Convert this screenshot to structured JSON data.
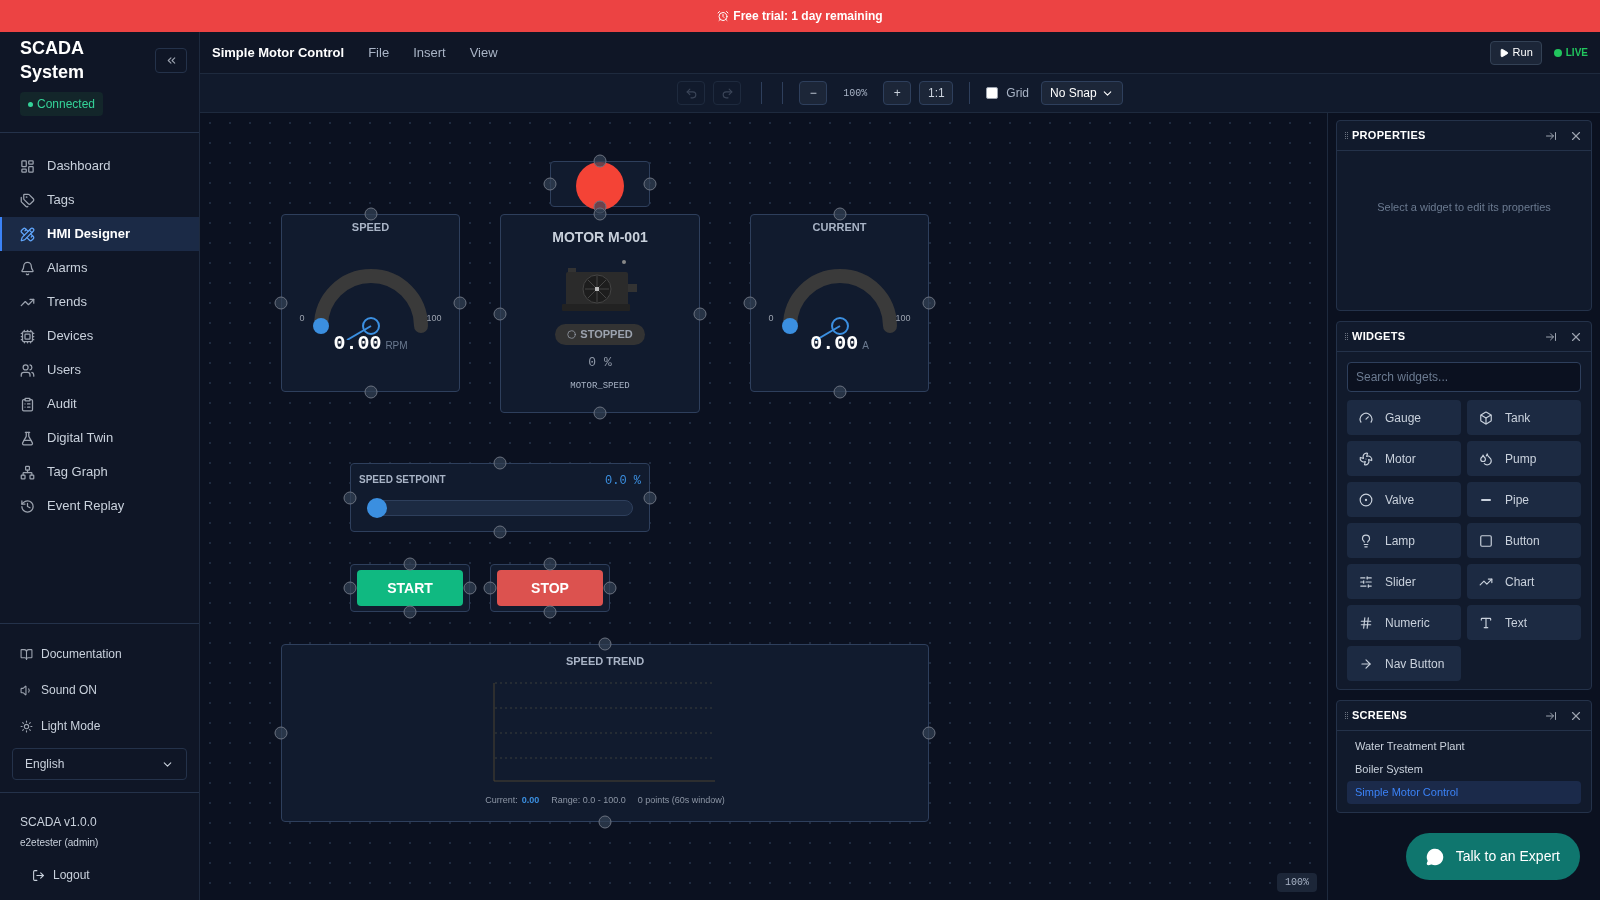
{
  "banner": {
    "text": "Free trial: 1 day remaining"
  },
  "sidebar": {
    "title": "SCADA System",
    "status": "Connected",
    "connected": true,
    "items": [
      {
        "label": "Dashboard",
        "selected": false
      },
      {
        "label": "Tags",
        "selected": false
      },
      {
        "label": "HMI Designer",
        "selected": true
      },
      {
        "label": "Alarms",
        "selected": false
      },
      {
        "label": "Trends",
        "selected": false
      },
      {
        "label": "Devices",
        "selected": false
      },
      {
        "label": "Users",
        "selected": false
      },
      {
        "label": "Audit",
        "selected": false
      },
      {
        "label": "Digital Twin",
        "selected": false
      },
      {
        "label": "Tag Graph",
        "selected": false
      },
      {
        "label": "Event Replay",
        "selected": false
      }
    ],
    "footer_items": [
      "Documentation",
      "Sound ON",
      "Light Mode"
    ],
    "language": "English",
    "version": "SCADA v1.0.0",
    "user": "e2etester (admin)",
    "logout": "Logout"
  },
  "menu": {
    "title": "Simple Motor Control",
    "items": [
      "File",
      "Insert",
      "View"
    ],
    "run": "Run",
    "live": "LIVE"
  },
  "toolbar": {
    "undo_disabled": true,
    "redo_disabled": true,
    "zoom_out": "−",
    "zoom": "100%",
    "zoom_in": "+",
    "reset": "1:1",
    "grid_label": "Grid",
    "grid_checked": false,
    "snap": "No Snap"
  },
  "canvas": {
    "widgets": [
      {
        "kind": "gauge",
        "title": "SPEED",
        "value": "0.00",
        "unit": "RPM",
        "min": "0",
        "max": "100",
        "level": 0
      },
      {
        "kind": "lamp",
        "on": true
      },
      {
        "kind": "motor",
        "title": "MOTOR M-001",
        "status": "STOPPED",
        "running": false,
        "value": "0 %",
        "tag": "MOTOR_SPEED"
      },
      {
        "kind": "gauge",
        "title": "CURRENT",
        "value": "0.00",
        "unit": "A",
        "min": "0",
        "max": "100",
        "level": 0
      },
      {
        "kind": "slider",
        "title": "SPEED SETPOINT",
        "reading": "0.0 %",
        "level": 0
      },
      {
        "kind": "button",
        "label": "START",
        "color": "#10b981"
      },
      {
        "kind": "button",
        "label": "STOP",
        "color": "#dc524f"
      },
      {
        "kind": "trend",
        "title": "SPEED TREND",
        "current_label": "Current:",
        "current": "0.00",
        "range": "Range: 0.0 - 100.0",
        "points": "0 points (60s window)"
      }
    ],
    "zoom": "100%"
  },
  "properties": {
    "title": "PROPERTIES",
    "empty": "Select a widget to edit its properties"
  },
  "widgets_panel": {
    "title": "WIDGETS",
    "search_placeholder": "Search widgets...",
    "items": [
      "Gauge",
      "Tank",
      "Motor",
      "Pump",
      "Valve",
      "Pipe",
      "Lamp",
      "Button",
      "Slider",
      "Chart",
      "Numeric",
      "Text",
      "Nav Button"
    ]
  },
  "screens": {
    "title": "SCREENS",
    "items": [
      {
        "label": "Water Treatment Plant",
        "selected": false
      },
      {
        "label": "Boiler System",
        "selected": false
      },
      {
        "label": "Simple Motor Control",
        "selected": true
      }
    ]
  },
  "chat": {
    "label": "Talk to an Expert"
  }
}
